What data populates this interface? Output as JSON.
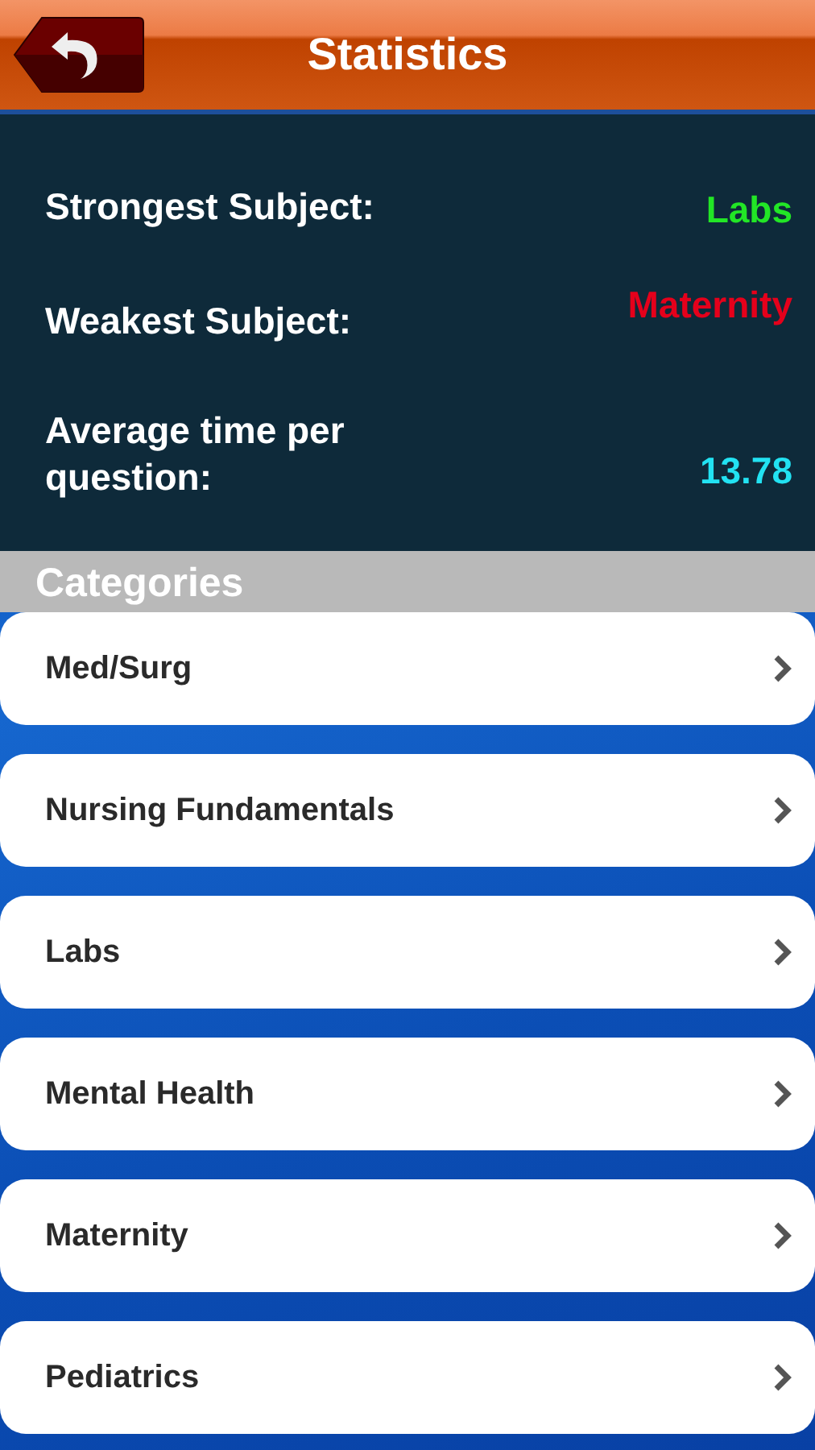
{
  "header": {
    "title": "Statistics"
  },
  "stats": [
    {
      "label": "Strongest Subject:",
      "value": "Labs",
      "color": "#22e626"
    },
    {
      "label": "Weakest Subject:",
      "value": "Maternity",
      "color": "#e5001b"
    },
    {
      "label": "Average time per question:",
      "value": "13.78",
      "color": "#22e2f2"
    }
  ],
  "categories": {
    "title": "Categories",
    "items": [
      {
        "label": "Med/Surg"
      },
      {
        "label": "Nursing Fundamentals"
      },
      {
        "label": "Labs"
      },
      {
        "label": "Mental Health"
      },
      {
        "label": "Maternity"
      },
      {
        "label": "Pediatrics"
      }
    ]
  }
}
